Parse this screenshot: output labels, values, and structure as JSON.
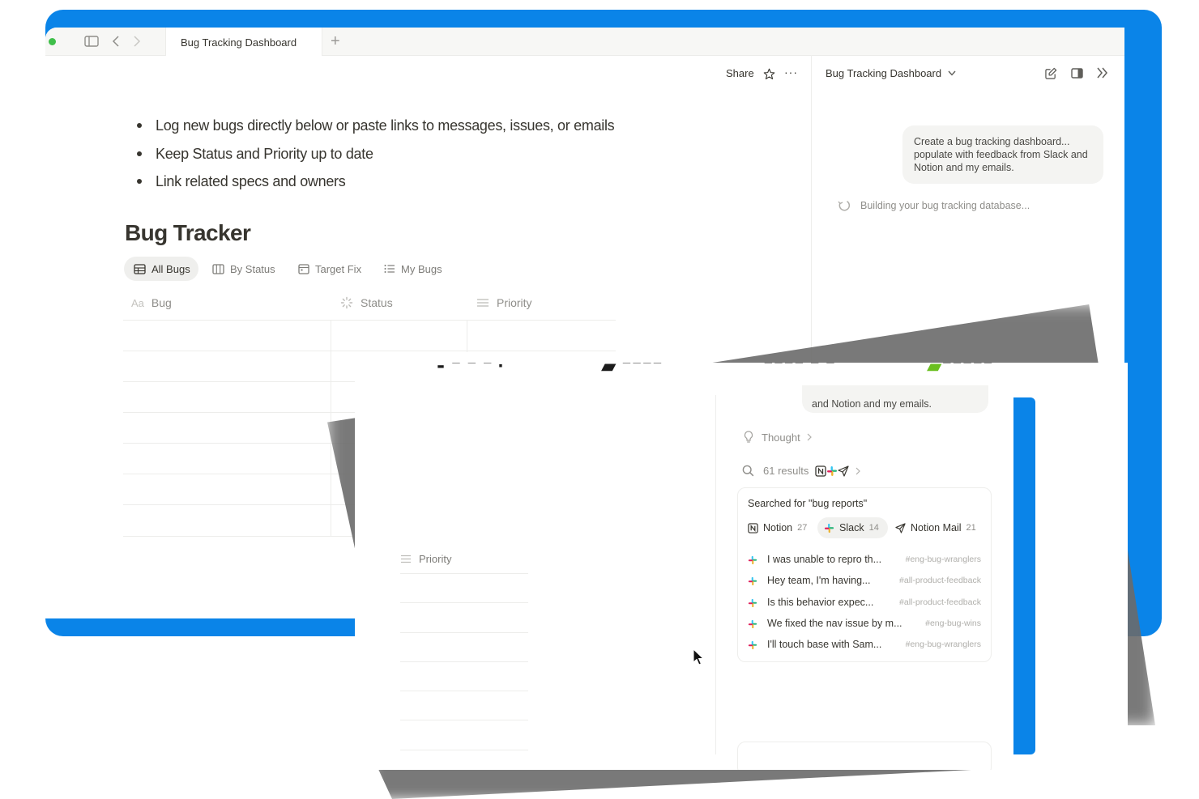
{
  "browser": {
    "tab_title": "Bug Tracking Dashboard",
    "new_tab": "+"
  },
  "topbar": {
    "share_label": "Share",
    "more_label": "···"
  },
  "page": {
    "bullets": [
      "Log new bugs directly below or paste links to messages, issues, or emails",
      "Keep Status and Priority up to date",
      "Link related specs and owners"
    ],
    "database": {
      "title": "Bug Tracker",
      "views": [
        "All Bugs",
        "By Status",
        "Target Fix",
        "My Bugs"
      ],
      "columns": {
        "bug_prefix": "Aa",
        "bug": "Bug",
        "status": "Status",
        "priority": "Priority"
      }
    }
  },
  "panel": {
    "title": "Bug Tracking Dashboard",
    "prompt": "Create a bug tracking dashboard... populate with feedback from Slack and Notion and my emails.",
    "building": "Building your bug tracking database..."
  },
  "front": {
    "prompt_tail": "and Notion and my emails.",
    "priority_label": "Priority",
    "thought": "Thought",
    "results_count": "61 results",
    "searched": "Searched for \"bug reports\"",
    "sources": [
      {
        "name": "Notion",
        "count": "27"
      },
      {
        "name": "Slack",
        "count": "14"
      },
      {
        "name": "Notion Mail",
        "count": "21"
      }
    ],
    "results": [
      {
        "text": "I was unable to repro th...",
        "channel": "#eng-bug-wranglers"
      },
      {
        "text": "Hey team, I'm having...",
        "channel": "#all-product-feedback"
      },
      {
        "text": "Is this behavior expec...",
        "channel": "#all-product-feedback"
      },
      {
        "text": "We fixed the nav issue by m...",
        "channel": "#eng-bug-wins"
      },
      {
        "text": "I'll touch base with Sam...",
        "channel": "#eng-bug-wranglers"
      }
    ]
  },
  "colors": {
    "accent_blue": "#0a84e8",
    "text": "#37352f",
    "muted": "#8f8e8a"
  },
  "icons": {
    "nav": [
      "sidebar-toggle-icon",
      "back-arrow-icon",
      "forward-arrow-icon"
    ],
    "topbar": [
      "star-icon",
      "more-icon"
    ],
    "panel": [
      "new-chat-icon",
      "panel-layout-icon",
      "collapse-icon",
      "spinner-icon"
    ],
    "front": [
      "lightbulb-icon",
      "search-icon",
      "slack-icon",
      "notion-icon",
      "send-icon",
      "cursor-icon"
    ]
  }
}
